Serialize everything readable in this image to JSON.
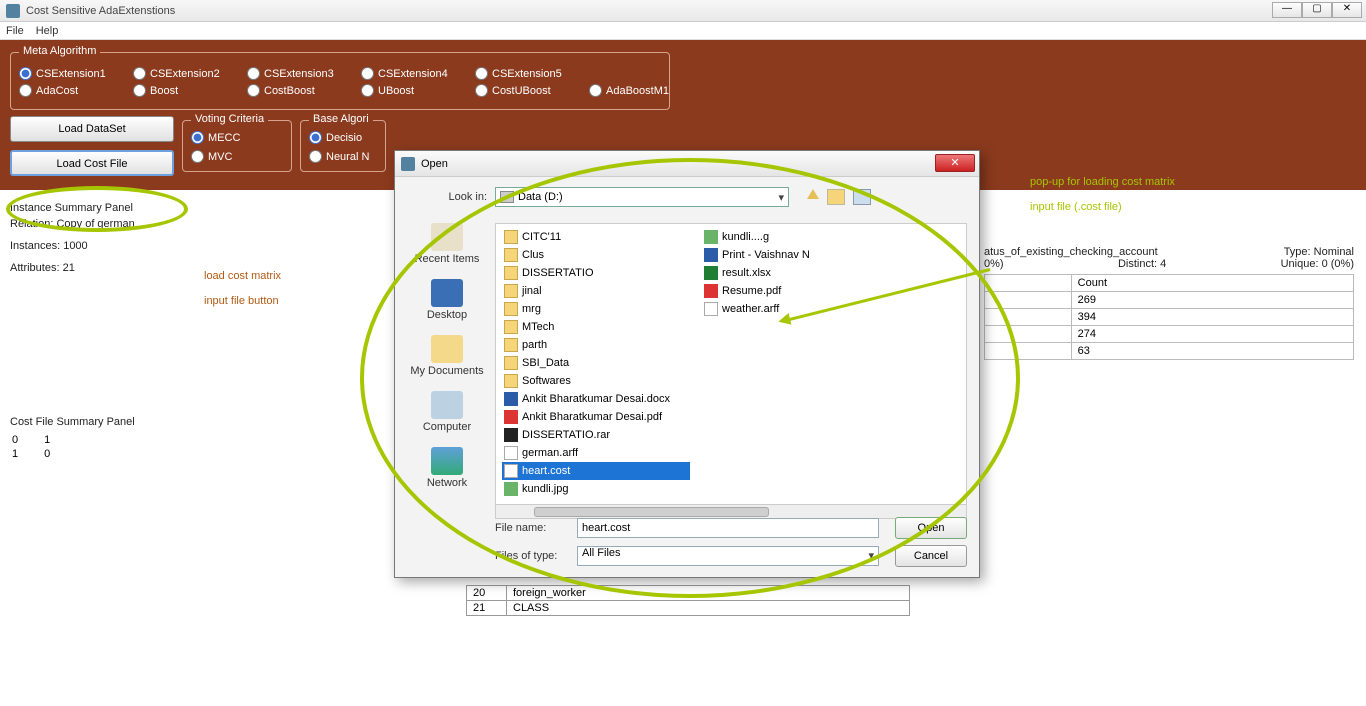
{
  "window": {
    "title": "Cost Sensitive AdaExtenstions"
  },
  "menubar": {
    "file": "File",
    "help": "Help"
  },
  "meta": {
    "legend": "Meta Algorithm",
    "row1": [
      "CSExtension1",
      "CSExtension2",
      "CSExtension3",
      "CSExtension4",
      "CSExtension5"
    ],
    "row2": [
      "AdaCost",
      "Boost",
      "CostBoost",
      "UBoost",
      "CostUBoost",
      "AdaBoostM1"
    ],
    "selected": "CSExtension1"
  },
  "buttons": {
    "load_dataset": "Load DataSet",
    "load_costfile": "Load Cost File"
  },
  "voting": {
    "legend": "Voting Criteria",
    "opts": [
      "MECC",
      "MVC"
    ],
    "selected": "MECC"
  },
  "base": {
    "legend": "Base Algori",
    "opts": [
      "Decisio",
      "Neural N"
    ],
    "selected": "Decisio"
  },
  "instance_panel": {
    "title": "Instance Summary Panel",
    "relation_lbl": "Relation: Copy of german",
    "instances_lbl": "Instances: 1000",
    "attributes_lbl": "Attributes: 21"
  },
  "costfile_panel": {
    "title": "Cost File Summary Panel",
    "rows": [
      [
        "0",
        "1"
      ],
      [
        "1",
        "0"
      ]
    ]
  },
  "attr_stats": {
    "name_prefix": "atus_of_existing_checking_account",
    "missing": "0%)",
    "type_lbl": "Type: Nominal",
    "distinct_lbl": "Distinct: 4",
    "unique_lbl": "Unique: 0 (0%)",
    "count_hdr": "Count",
    "counts": [
      "269",
      "394",
      "274",
      "63"
    ]
  },
  "attr_table_tail": [
    [
      "20",
      "foreign_worker"
    ],
    [
      "21",
      "CLASS"
    ]
  ],
  "dialog": {
    "title": "Open",
    "lookin_lbl": "Look in:",
    "lookin_val": "Data (D:)",
    "places": [
      "Recent Items",
      "Desktop",
      "My Documents",
      "Computer",
      "Network"
    ],
    "files_col1": [
      {
        "n": "CITC'11",
        "t": "folder"
      },
      {
        "n": "Clus",
        "t": "folder"
      },
      {
        "n": "DISSERTATIO",
        "t": "folder"
      },
      {
        "n": "jinal",
        "t": "folder"
      },
      {
        "n": "mrg",
        "t": "folder"
      },
      {
        "n": "MTech",
        "t": "folder"
      },
      {
        "n": "parth",
        "t": "folder"
      },
      {
        "n": "SBI_Data",
        "t": "folder"
      },
      {
        "n": "Softwares",
        "t": "folder"
      },
      {
        "n": "Ankit Bharatkumar Desai.docx",
        "t": "docx"
      },
      {
        "n": "Ankit Bharatkumar Desai.pdf",
        "t": "pdf"
      },
      {
        "n": "DISSERTATIO.rar",
        "t": "rar"
      },
      {
        "n": "german.arff",
        "t": "file"
      },
      {
        "n": "heart.cost",
        "t": "costfile",
        "sel": true
      },
      {
        "n": "kundli.jpg",
        "t": "img"
      }
    ],
    "files_col2": [
      {
        "n": "kundli....g",
        "t": "img"
      },
      {
        "n": "Print - Vaishnav N",
        "t": "docx"
      },
      {
        "n": "result.xlsx",
        "t": "xls"
      },
      {
        "n": "Resume.pdf",
        "t": "pdf"
      },
      {
        "n": "weather.arff",
        "t": "file"
      }
    ],
    "filename_lbl": "File name:",
    "filename_val": "heart.cost",
    "filetype_lbl": "Files of type:",
    "filetype_val": "All Files",
    "open_btn": "Open",
    "cancel_btn": "Cancel"
  },
  "annotations": {
    "a1_l1": "load cost matrix",
    "a1_l2": "input file button",
    "a2_l1": "pop-up for loading cost matrix",
    "a2_l2": "input file (.cost file)"
  }
}
